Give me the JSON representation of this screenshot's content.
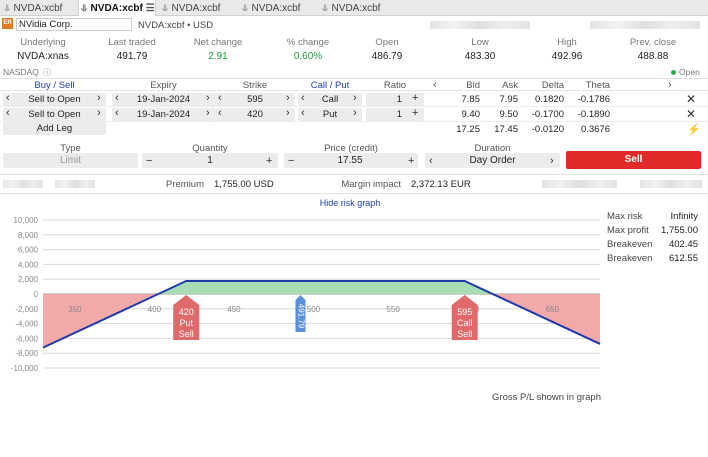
{
  "tabs": [
    {
      "label": "NVDA:xcbf",
      "active": false
    },
    {
      "label": "NVDA:xcbf",
      "active": true
    },
    {
      "label": "NVDA:xcbf",
      "active": false
    },
    {
      "label": "NVDA:xcbf",
      "active": false
    },
    {
      "label": "NVDA:xcbf",
      "active": false
    }
  ],
  "instrument": {
    "badge": "ER",
    "name": "NVidia Corp.",
    "symbol": "NVDA:xcbf • USD"
  },
  "quote": {
    "labels": [
      "Underlying",
      "Last traded",
      "Net change",
      "% change",
      "Open",
      "Low",
      "High",
      "Prev. close"
    ],
    "values": [
      "NVDA:xnas",
      "491.79",
      "2.91",
      "0.60%",
      "486.79",
      "483.30",
      "492.96",
      "488.88"
    ]
  },
  "exchange": "NASDAQ",
  "status": "Open",
  "legs_header": {
    "buy_sell": "Buy / Sell",
    "expiry": "Expiry",
    "strike": "Strike",
    "call_put": "Call / Put",
    "ratio": "Ratio",
    "bid": "Bid",
    "ask": "Ask",
    "delta": "Delta",
    "theta": "Theta"
  },
  "legs": [
    {
      "buy_sell": "Sell to Open",
      "expiry": "19-Jan-2024",
      "strike": "595",
      "call_put": "Call",
      "ratio": "1",
      "bid": "7.85",
      "ask": "7.95",
      "delta": "0.1820",
      "theta": "-0.1786"
    },
    {
      "buy_sell": "Sell to Open",
      "expiry": "19-Jan-2024",
      "strike": "420",
      "call_put": "Put",
      "ratio": "1",
      "bid": "9.40",
      "ask": "9.50",
      "delta": "-0.1700",
      "theta": "-0.1890"
    }
  ],
  "totals": {
    "bid": "17.25",
    "ask": "17.45",
    "delta": "-0.0120",
    "theta": "0.3676"
  },
  "add_leg": "Add Leg",
  "order": {
    "type_label": "Type",
    "type_value": "Limit",
    "quantity_label": "Quantity",
    "quantity_value": "1",
    "price_label": "Price (credit)",
    "price_value": "17.55",
    "duration_label": "Duration",
    "duration_value": "Day Order",
    "sell": "Sell"
  },
  "summary": {
    "premium_label": "Premium",
    "premium_value": "1,755.00 USD",
    "margin_label": "Margin impact",
    "margin_value": "2,372.13 EUR"
  },
  "hide_risk": "Hide risk graph",
  "risk": {
    "max_risk_label": "Max risk",
    "max_risk": "Infinity",
    "max_profit_label": "Max profit",
    "max_profit": "1,755.00",
    "breakeven_label": "Breakeven",
    "breakeven1": "402.45",
    "breakeven2": "612.55"
  },
  "footnote": "Gross P/L shown in graph",
  "chart_data": {
    "type": "line",
    "y_ticks": [
      "10,000",
      "8,000",
      "6,000",
      "4,000",
      "2,000",
      "0",
      "-2,000",
      "-4,000",
      "-6,000",
      "-8,000",
      "-10,000"
    ],
    "x_ticks": [
      "350",
      "400",
      "450",
      "500",
      "550",
      "600",
      "650"
    ],
    "x_range": [
      330,
      680
    ],
    "y_range": [
      -10000,
      10000
    ],
    "payoff": [
      {
        "x": 330,
        "y": -7245
      },
      {
        "x": 420,
        "y": 1755
      },
      {
        "x": 595,
        "y": 1755
      },
      {
        "x": 680,
        "y": -6745
      }
    ],
    "markers": [
      {
        "lines": [
          "420",
          "Put",
          "Sell"
        ],
        "x": 420,
        "color": "#e06969"
      },
      {
        "label": "491.79",
        "x": 491.79,
        "color": "#5b8fd8"
      },
      {
        "lines": [
          "595",
          "Call",
          "Sell"
        ],
        "x": 595,
        "color": "#e06969"
      }
    ],
    "colors": {
      "profit": "#a8dcb4",
      "loss": "#f2a9a9",
      "line": "#1f3aa8"
    }
  }
}
